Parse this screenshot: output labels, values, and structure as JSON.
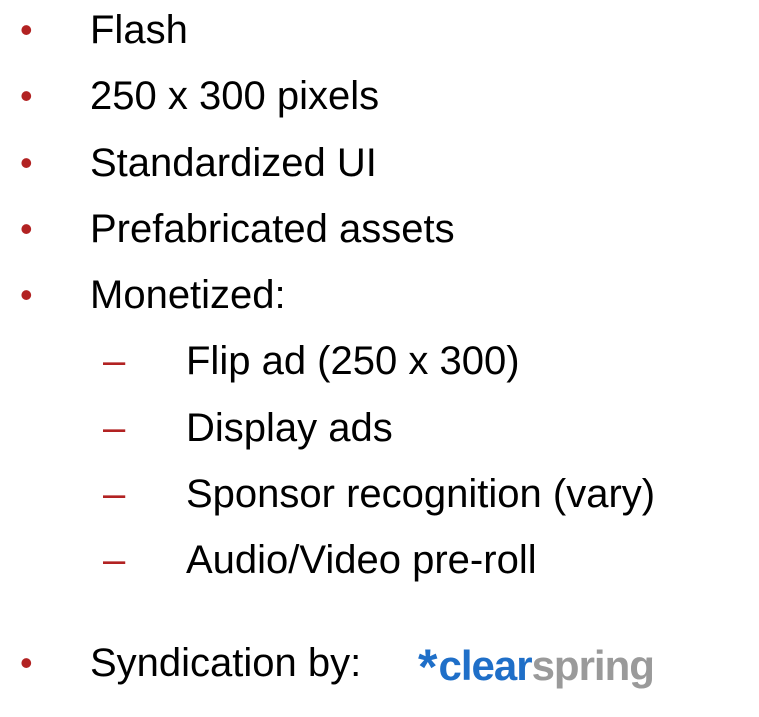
{
  "bullets": {
    "top_level_marker": "•",
    "sub_level_marker": "–",
    "items": [
      {
        "text": "Flash"
      },
      {
        "text": "250 x 300 pixels"
      },
      {
        "text": "Standardized UI"
      },
      {
        "text": "Prefabricated assets"
      },
      {
        "text": "Monetized:"
      }
    ],
    "monetized_subitems": [
      {
        "text": "Flip ad (250 x 300)"
      },
      {
        "text": "Display ads"
      },
      {
        "text": "Sponsor recognition (vary)"
      },
      {
        "text": "Audio/Video pre-roll"
      }
    ],
    "syndication": {
      "text": "Syndication by:"
    }
  },
  "logo": {
    "star": "*",
    "part1": "clear",
    "part2": "spring",
    "colors": {
      "star": "#1f6fc8",
      "part1": "#1f6fc8",
      "part2": "#9a9a9a"
    }
  },
  "colors": {
    "bullet_marker": "#b22222",
    "text": "#000000",
    "background": "#ffffff"
  }
}
